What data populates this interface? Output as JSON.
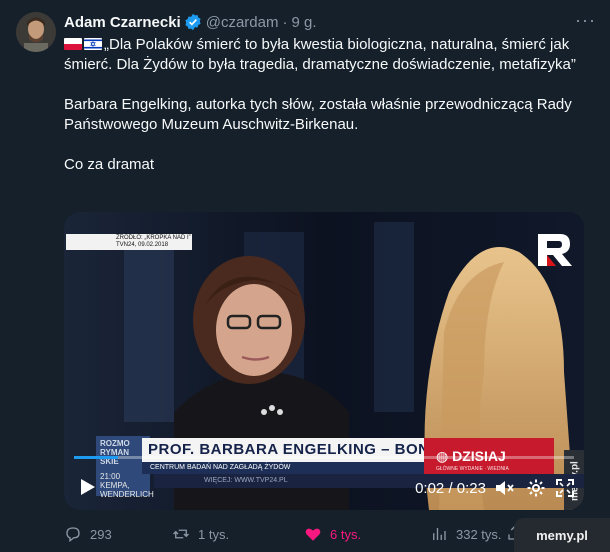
{
  "author": {
    "name": "Adam Czarnecki",
    "handle": "@czardam",
    "time": "9 g."
  },
  "tweet": {
    "flags": [
      "poland-flag",
      "israel-flag"
    ],
    "line1": "„Dla Polaków śmierć to była kwestia biologiczna, naturalna, śmierć jak śmierć. Dla Żydów to była tragedia, dramatyczne doświadczenie, metafizyka”",
    "line2": "Barbara Engelking, autorka tych słów, została właśnie przewodniczącą Rady Państwowego Muzeum Auschwitz-Birkenau.",
    "line3": "Co za dramat"
  },
  "video": {
    "source_line1": "ŹRÓDŁO: „KROPKA NAD I”",
    "source_line2": "TVN24, 09.02.2018",
    "left_ticker_line1": "ROZMO",
    "left_ticker_line2": "RYMAN",
    "left_ticker_line3": "SKIE",
    "left_ticker_time": "21:00",
    "left_ticker_sub1": "KEMPA,",
    "left_ticker_sub2": "WENDERLICH",
    "lower_third_title": "PROF. BARBARA ENGELKING – BONI",
    "lower_third_sub": "CENTRUM BADAŃ NAD ZAGŁADĄ ŻYDÓW",
    "program_name": "DZISIAJ",
    "program_sub": "GŁÓWNE WYDANIE · WIEDNIA",
    "bottom_strip": "WIĘCEJ: WWW.TVP24.PL",
    "current_time": "0:02",
    "duration": "0:23",
    "progress": 0.087
  },
  "watermark": {
    "vertical": "memy.pl",
    "badge": "memy.pl"
  },
  "stats": {
    "replies": "293",
    "retweets": "1 tys.",
    "likes": "6 tys.",
    "views": "332 tys."
  },
  "colors": {
    "background": "#15202b",
    "text": "#f7f9f9",
    "muted": "#8b98a5",
    "accent": "#1d9bf0",
    "like": "#f91880"
  }
}
